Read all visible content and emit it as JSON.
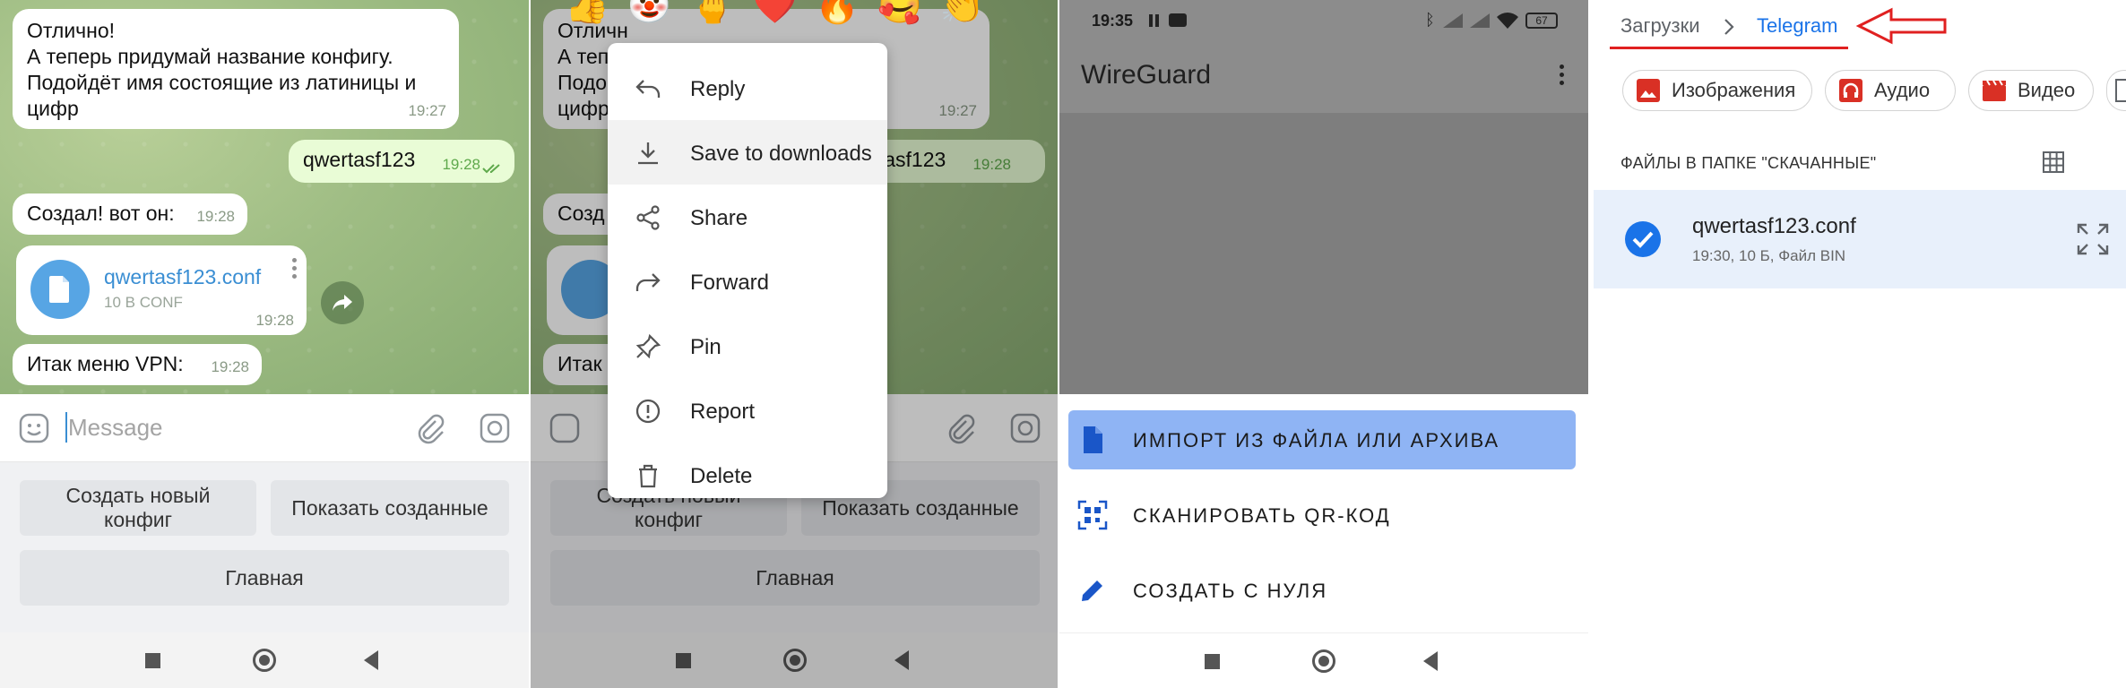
{
  "chat": {
    "msg1_text": "Отлично!\nА теперь придумай название конфигу.\nПодойдёт имя состоящие из латиницы и цифр",
    "msg1_time": "19:27",
    "msg2_text": "qwertasf123",
    "msg2_time": "19:28",
    "msg3_text": "Создал! вот он:",
    "msg3_time": "19:28",
    "file_name": "qwertasf123.conf",
    "file_meta": "10 B CONF",
    "file_time": "19:28",
    "msg4_text": "Итак меню VPN:",
    "msg4_time": "19:28",
    "input_placeholder": "Message",
    "keyboard": {
      "btn_create": "Создать новый\nконфиг",
      "btn_show": "Показать созданные",
      "btn_main": "Главная"
    }
  },
  "context_menu": {
    "reactions": [
      "👍",
      "🤡",
      "🖕",
      "❤️",
      "🔥",
      "🥰",
      "👏"
    ],
    "items": [
      {
        "label": "Reply",
        "icon": "reply-icon"
      },
      {
        "label": "Save to downloads",
        "icon": "download-icon"
      },
      {
        "label": "Share",
        "icon": "share-icon"
      },
      {
        "label": "Forward",
        "icon": "forward-icon"
      },
      {
        "label": "Pin",
        "icon": "pin-icon"
      },
      {
        "label": "Report",
        "icon": "report-icon"
      },
      {
        "label": "Delete",
        "icon": "trash-icon"
      }
    ],
    "bg_texts": {
      "l1": "Отличн",
      "l2": "А тепе",
      "l3": "Подойд",
      "l4": "цифр",
      "time1": "19:27",
      "out_text": "qwertasf123",
      "out_time": "19:28",
      "created": "Созд",
      "itak": "Итак"
    }
  },
  "wireguard": {
    "status_time": "19:35",
    "battery": "67",
    "app_title": "WireGuard",
    "options": [
      {
        "label": "ИМПОРТ ИЗ ФАЙЛА ИЛИ АРХИВА",
        "icon": "file-icon"
      },
      {
        "label": "СКАНИРОВАТЬ QR-КОД",
        "icon": "qr-icon"
      },
      {
        "label": "СОЗДАТЬ С НУЛЯ",
        "icon": "pencil-icon"
      }
    ]
  },
  "files": {
    "breadcrumb_root": "Загрузки",
    "breadcrumb_current": "Telegram",
    "chips": [
      "Изображения",
      "Аудио",
      "Видео"
    ],
    "section_title": "ФАЙЛЫ В ПАПКЕ \"СКАЧАННЫЕ\"",
    "file_name": "qwertasf123.conf",
    "file_meta": "19:30, 10 Б, Файл BIN"
  },
  "colors": {
    "telegram_link": "#3a8ed3",
    "wg_highlight": "#8fb4f4",
    "files_accent": "#1a73e8",
    "annotation_red": "#e02020"
  }
}
